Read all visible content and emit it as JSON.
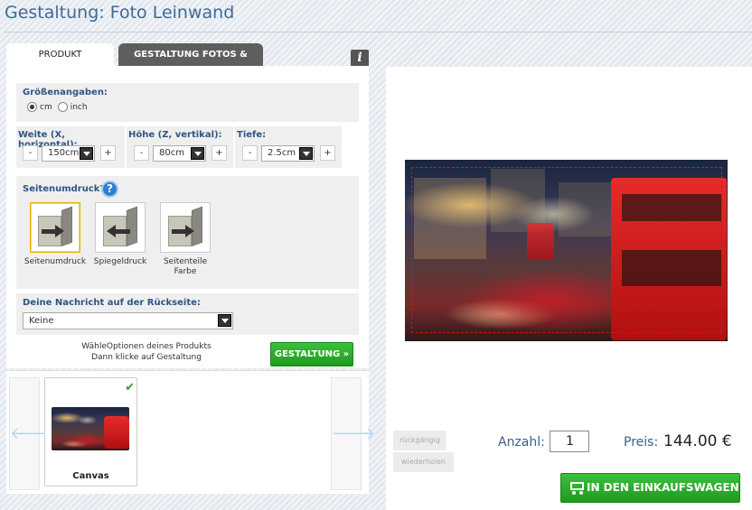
{
  "page": {
    "title": "Gestaltung: Foto Leinwand"
  },
  "tabs": [
    {
      "label": "PRODUKT OPTIONEN",
      "active": true
    },
    {
      "label": "GESTALTUNG FOTOS & TEXT",
      "active": false
    }
  ],
  "info_icon": "i",
  "size_section": {
    "label": "Größenangaben:",
    "units": [
      {
        "label": "cm",
        "selected": true
      },
      {
        "label": "inch",
        "selected": false
      }
    ]
  },
  "dimensions": {
    "width": {
      "label": "Weite (X, horizontal):",
      "value": "150cm",
      "minus": "-",
      "plus": "+"
    },
    "height": {
      "label": "Höhe (Z, vertikal):",
      "value": "80cm",
      "minus": "-",
      "plus": "+"
    },
    "depth": {
      "label": "Tiefe:",
      "value": "2.5cm",
      "minus": "-",
      "plus": "+"
    }
  },
  "side_print": {
    "label": "Seitenumdruck?:",
    "help": "?",
    "options": [
      {
        "label": "Seitenumdruck",
        "selected": true
      },
      {
        "label": "Spiegeldruck",
        "selected": false
      },
      {
        "label": "Seitenteile Farbe",
        "selected": false
      }
    ]
  },
  "message": {
    "label": "Deine Nachricht auf der Rückseite:",
    "value": "Keine"
  },
  "hint": {
    "line1": "WähleOptionen deines Produkts",
    "line2": "Dann klicke auf Gestaltung"
  },
  "gestaltung_button": "GESTALTUNG »",
  "carousel": {
    "prev": "🡐",
    "next": "🡒",
    "items": [
      {
        "label": "Canvas",
        "selected": true
      }
    ]
  },
  "actions": {
    "undo": "rückgängig",
    "redo": "wiederholen"
  },
  "order": {
    "quantity_label": "Anzahl:",
    "quantity": "1",
    "price_label": "Preis:",
    "price": "144.00 €",
    "cart_button": "IN DEN EINKAUFSWAGEN"
  },
  "colors": {
    "title": "#3f6a96",
    "green": "#2aa52a",
    "label_blue": "#2f5583"
  }
}
